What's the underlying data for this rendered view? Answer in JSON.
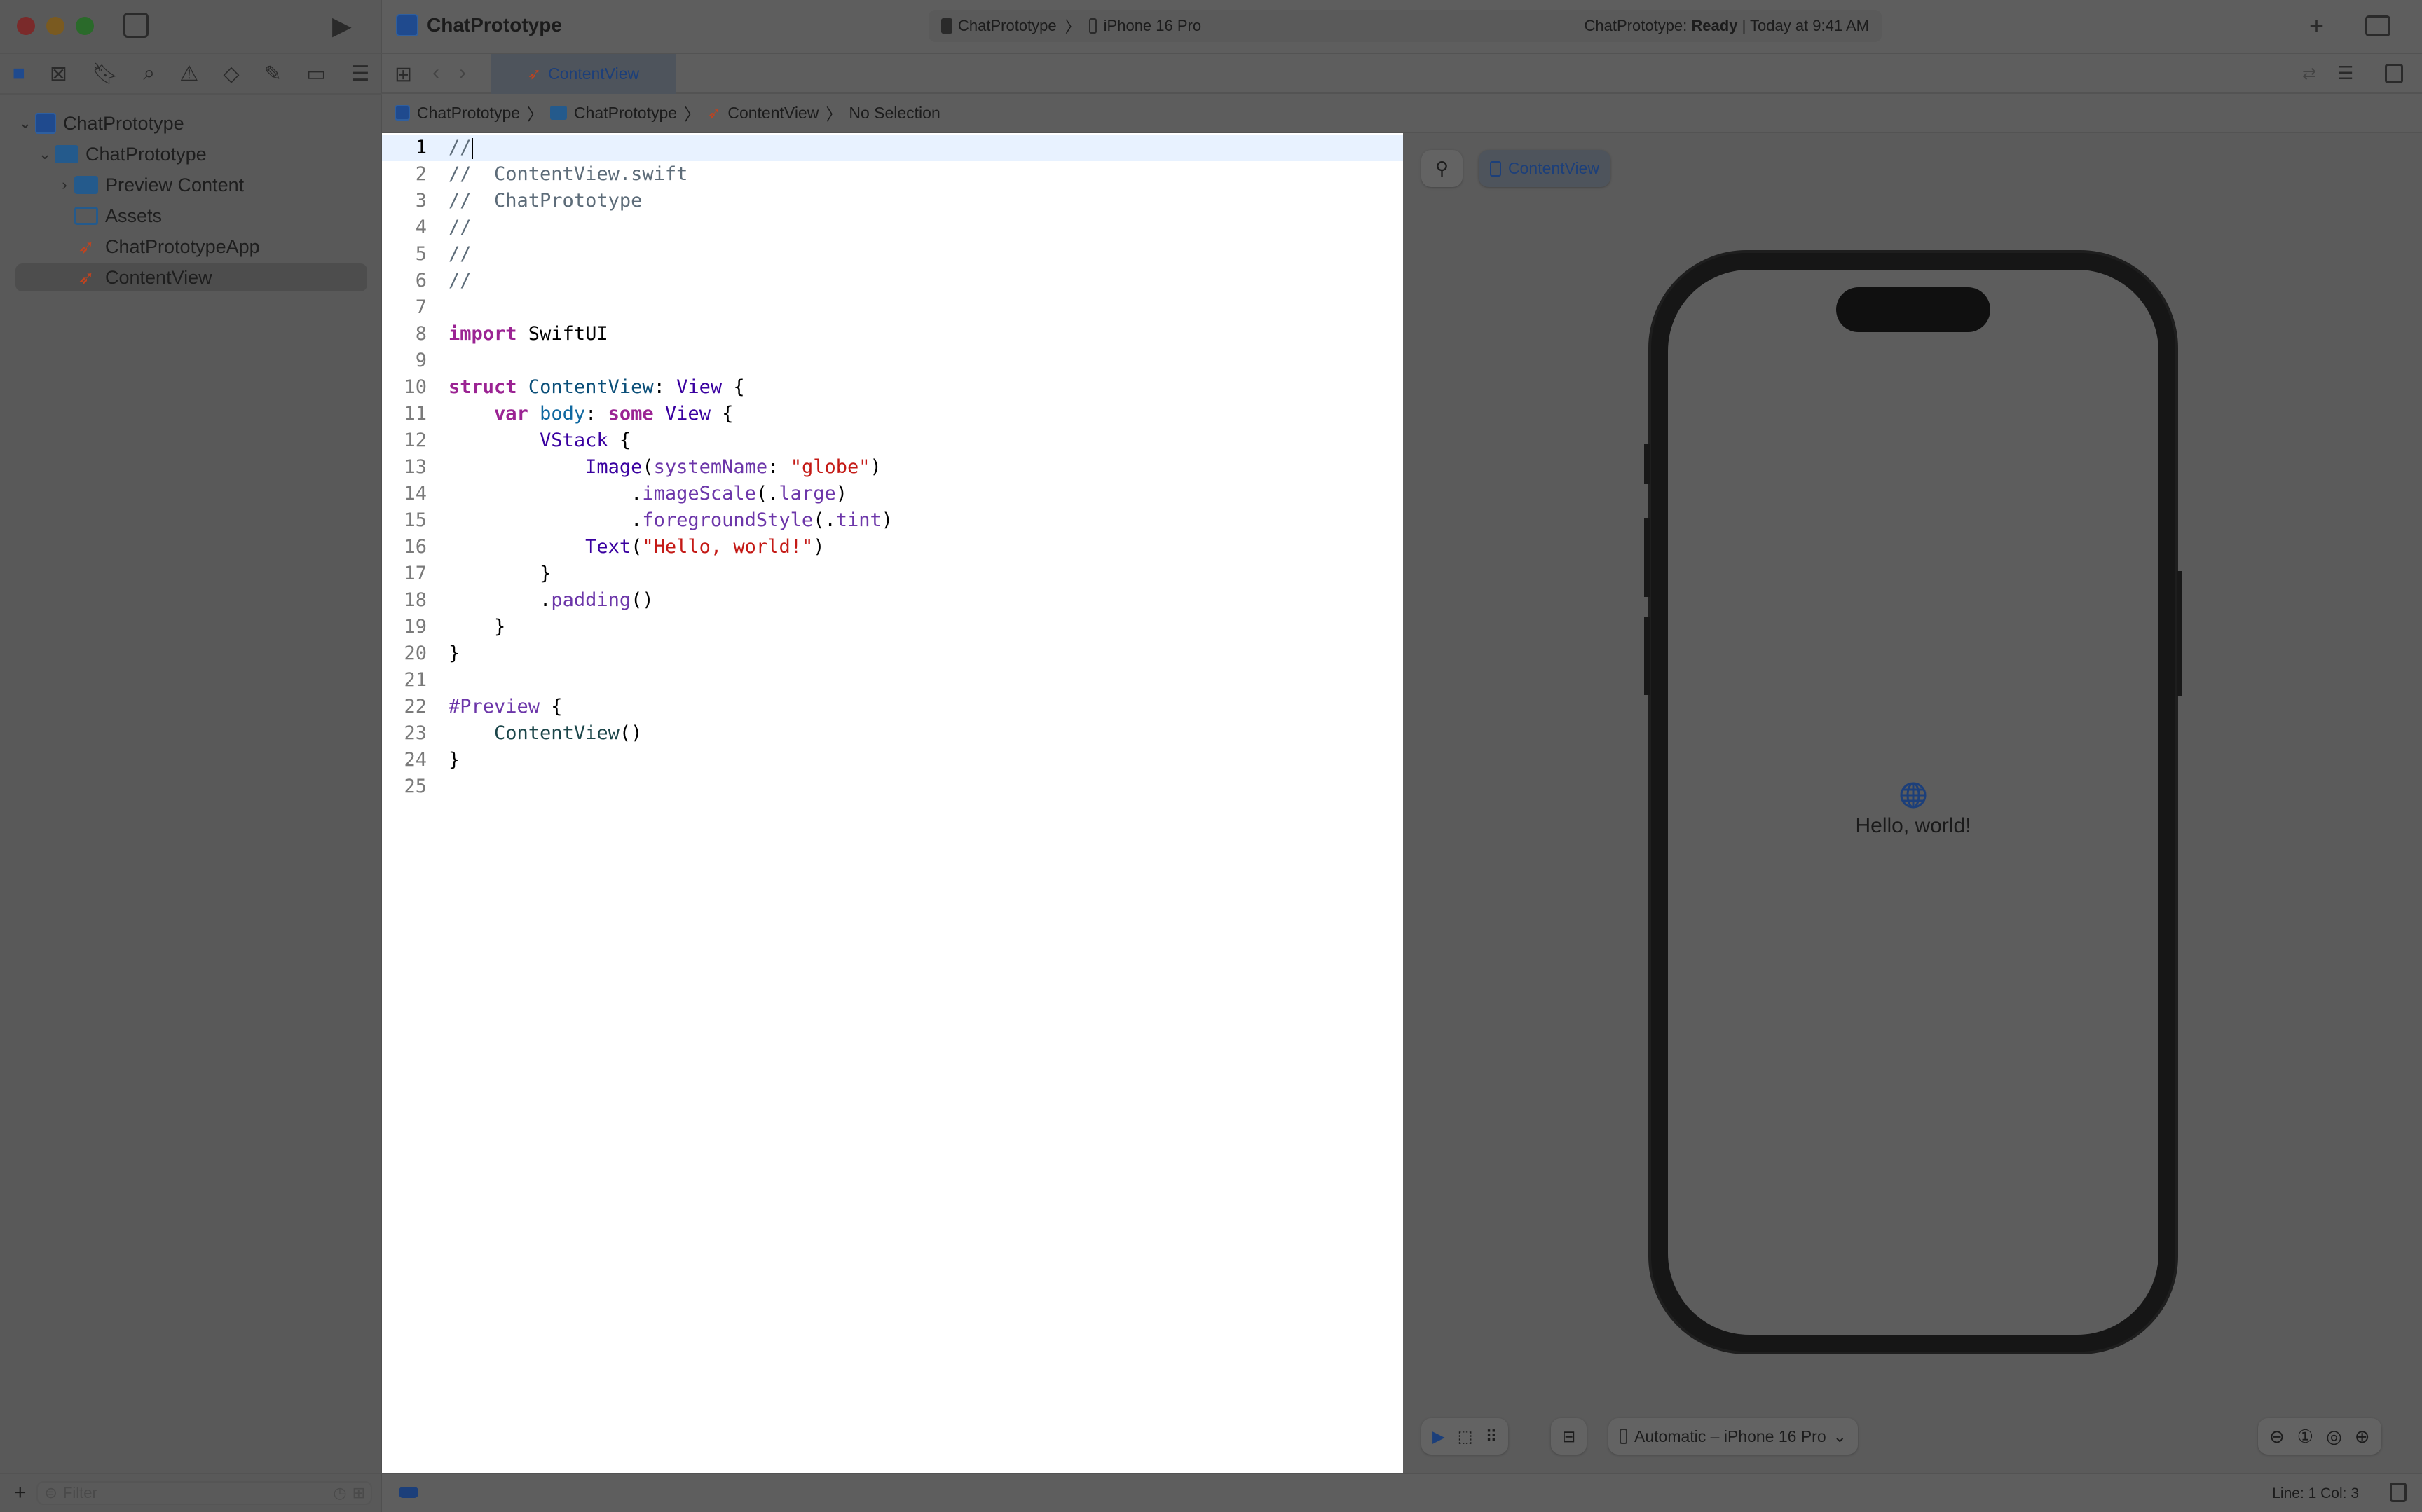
{
  "window": {
    "project": "ChatPrototype",
    "scheme": "ChatPrototype",
    "device": "iPhone 16 Pro",
    "status_prefix": "ChatPrototype: ",
    "status_state": "Ready",
    "status_time": " | Today at 9:41 AM"
  },
  "tab": {
    "label": "ContentView"
  },
  "jumpbar": [
    "ChatPrototype",
    "ChatPrototype",
    "ContentView",
    "No Selection"
  ],
  "navigator": {
    "items": [
      {
        "label": "ChatPrototype",
        "icon": "project-icon",
        "disclosure": "expanded"
      },
      {
        "label": "ChatPrototype",
        "icon": "folder-icon",
        "disclosure": "expanded"
      },
      {
        "label": "Preview Content",
        "icon": "folder-icon",
        "disclosure": "collapsed"
      },
      {
        "label": "Assets",
        "icon": "asset-catalog-icon"
      },
      {
        "label": "ChatPrototypeApp",
        "icon": "swift-file-icon"
      },
      {
        "label": "ContentView",
        "icon": "swift-file-icon",
        "selected": true
      }
    ],
    "filter_placeholder": "Filter"
  },
  "code": [
    [
      [
        "//",
        "comment"
      ]
    ],
    [
      [
        "//  ContentView.swift",
        "comment"
      ]
    ],
    [
      [
        "//  ChatPrototype",
        "comment"
      ]
    ],
    [
      [
        "//",
        "comment"
      ]
    ],
    [
      [
        "//",
        "comment"
      ]
    ],
    [
      [
        "//",
        "comment"
      ]
    ],
    [],
    [
      [
        "import",
        "keyword"
      ],
      [
        " SwiftUI",
        "plain"
      ]
    ],
    [],
    [
      [
        "struct",
        "keyword"
      ],
      [
        " ",
        "plain"
      ],
      [
        "ContentView",
        "typedecl"
      ],
      [
        ": ",
        "plain"
      ],
      [
        "View",
        "type"
      ],
      [
        " {",
        "plain"
      ]
    ],
    [
      [
        "    ",
        "plain"
      ],
      [
        "var",
        "keyword"
      ],
      [
        " ",
        "plain"
      ],
      [
        "body",
        "decl"
      ],
      [
        ": ",
        "plain"
      ],
      [
        "some",
        "keyword"
      ],
      [
        " ",
        "plain"
      ],
      [
        "View",
        "type"
      ],
      [
        " {",
        "plain"
      ]
    ],
    [
      [
        "        ",
        "plain"
      ],
      [
        "VStack",
        "type"
      ],
      [
        " {",
        "plain"
      ]
    ],
    [
      [
        "            ",
        "plain"
      ],
      [
        "Image",
        "type"
      ],
      [
        "(",
        "plain"
      ],
      [
        "systemName",
        "member"
      ],
      [
        ": ",
        "plain"
      ],
      [
        "\"globe\"",
        "string"
      ],
      [
        ")",
        "plain"
      ]
    ],
    [
      [
        "                .",
        "plain"
      ],
      [
        "imageScale",
        "member"
      ],
      [
        "(.",
        "plain"
      ],
      [
        "large",
        "member"
      ],
      [
        ")",
        "plain"
      ]
    ],
    [
      [
        "                .",
        "plain"
      ],
      [
        "foregroundStyle",
        "member"
      ],
      [
        "(.",
        "plain"
      ],
      [
        "tint",
        "member"
      ],
      [
        ")",
        "plain"
      ]
    ],
    [
      [
        "            ",
        "plain"
      ],
      [
        "Text",
        "type"
      ],
      [
        "(",
        "plain"
      ],
      [
        "\"Hello, world!\"",
        "string"
      ],
      [
        ")",
        "plain"
      ]
    ],
    [
      [
        "        }",
        "plain"
      ]
    ],
    [
      [
        "        .",
        "plain"
      ],
      [
        "padding",
        "member"
      ],
      [
        "()",
        "plain"
      ]
    ],
    [
      [
        "    }",
        "plain"
      ]
    ],
    [
      [
        "}",
        "plain"
      ]
    ],
    [],
    [
      [
        "#Preview",
        "member"
      ],
      [
        " {",
        "plain"
      ]
    ],
    [
      [
        "    ",
        "plain"
      ],
      [
        "ContentView",
        "call"
      ],
      [
        "()",
        "plain"
      ]
    ],
    [
      [
        "}",
        "plain"
      ]
    ],
    []
  ],
  "preview": {
    "chip": "ContentView",
    "text": "Hello, world!",
    "device_menu": "Automatic – iPhone 16 Pro",
    "accent": "#1c3f7a"
  },
  "statusbar": {
    "position": "Line: 1  Col: 3"
  }
}
